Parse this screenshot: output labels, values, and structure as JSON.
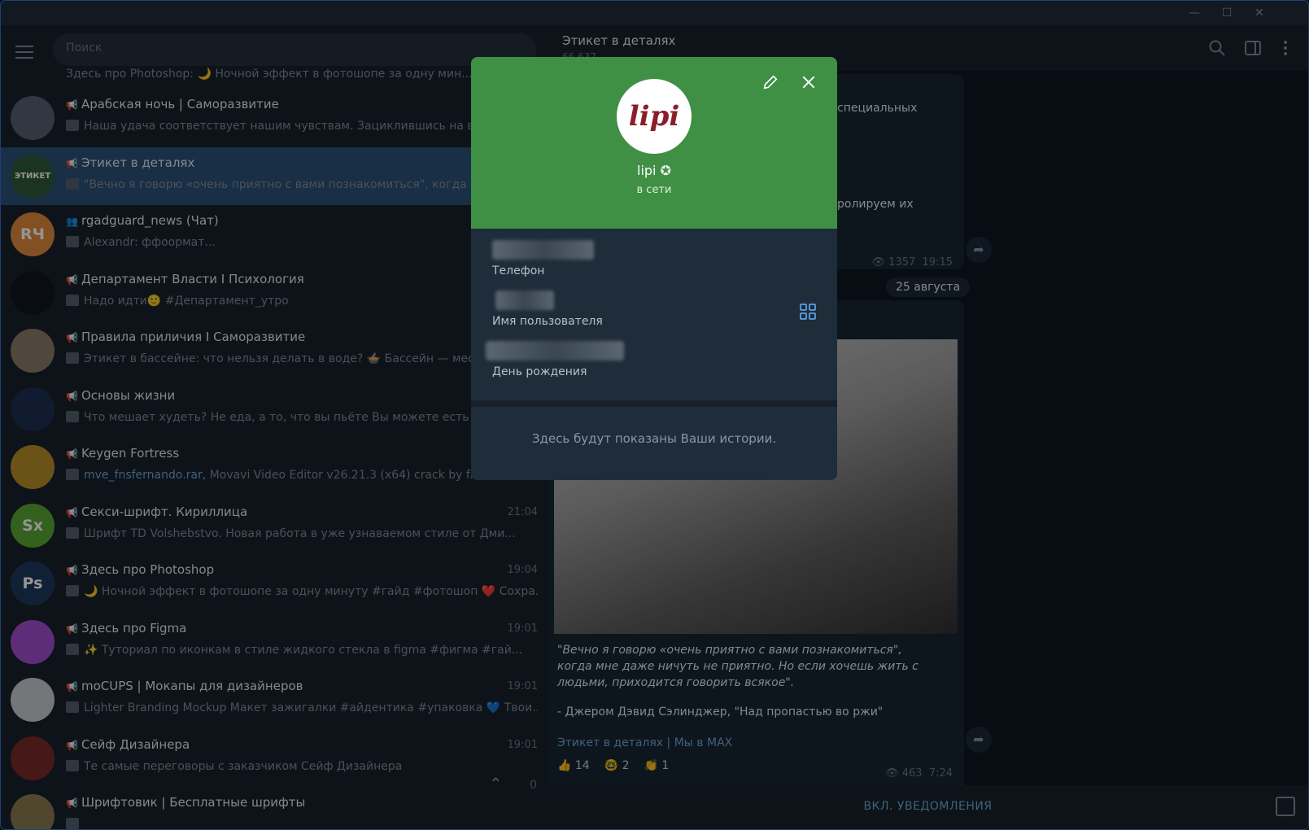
{
  "search": {
    "placeholder": "Поиск"
  },
  "chats": [
    {
      "name": "Арабская ночь | Саморазвитие",
      "time": "",
      "preview": "Наша удача соответствует нашим чувствам. Зациклившись на все...",
      "avatar": "",
      "color": "#566070",
      "link": ""
    },
    {
      "name": "Этикет в деталях",
      "time": "",
      "preview": "\"Вечно я говорю «очень приятно с вами познакомиться\", когда мне...",
      "avatar": "ЭТИКЕТ",
      "color": "#2e5a3a",
      "link": "",
      "selected": true
    },
    {
      "name": "rgadguard_news (Чат)",
      "time": "",
      "preview": "Alexandr: ффоормат...",
      "avatar": "RЧ",
      "color": "#e08a3c",
      "link": ""
    },
    {
      "name": "Департамент Власти I Психология",
      "time": "",
      "preview": "Надо идти🙂 #Департамент_утро",
      "avatar": "",
      "color": "#101820",
      "link": ""
    },
    {
      "name": "Правила приличия I Саморазвитие",
      "time": "",
      "preview": "Этикет в бассейне: что нельзя делать в воде? 🍲 Бассейн — место...",
      "avatar": "",
      "color": "#8a7a6a",
      "link": ""
    },
    {
      "name": "Основы жизни",
      "time": "",
      "preview": "Что мешает худеть? Не еда, а то, что вы пьёте  Вы можете есть пр...",
      "avatar": "",
      "color": "#1d2f52",
      "link": ""
    },
    {
      "name": "Keygen Fortress",
      "time": "",
      "preview": "Movavi Video Editor v26.21.3 (x64) crack by fnsfernando...",
      "avatar": "",
      "color": "#b8902a",
      "link": "mve_fnsfernando.rar,"
    },
    {
      "name": "Секси-шрифт. Кириллица",
      "time": "21:04",
      "preview": "Шрифт TD Volshebstvo. Новая работа в уже узнаваемом стиле от Дми...",
      "avatar": "Sx",
      "color": "#5aa832",
      "link": ""
    },
    {
      "name": "Здесь про Photoshop",
      "time": "19:04",
      "preview": "🌙 Ночной эффект в фотошопе за одну минуту #гайд #фотошоп  ❤️ Сохра...",
      "avatar": "Ps",
      "color": "#1c3a5e",
      "link": ""
    },
    {
      "name": "Здесь про Figma",
      "time": "19:01",
      "preview": "✨ Туториал по иконкам в стиле жидкого стекла в figma #фигма #гай...",
      "avatar": "",
      "color": "#a24fd0",
      "link": ""
    },
    {
      "name": "moCUPS | Мокапы для дизайнеров",
      "time": "19:01",
      "preview": "Lighter Branding Mockup  Макет зажигалки  #айдентика #упаковка  💙 Твои...",
      "avatar": "",
      "color": "#c8ccd0",
      "link": ""
    },
    {
      "name": "Сейф Дизайнера",
      "time": "19:01",
      "preview": "Те самые переговоры с заказчиком  Сейф Дизайнера",
      "avatar": "",
      "color": "#7a2a2a",
      "link": ""
    },
    {
      "name": "Шрифтовик | Бесплатные шрифты",
      "time": "",
      "preview": "",
      "avatar": "",
      "color": "#8a7a52",
      "link": ""
    }
  ],
  "top_preview": "Здесь про Photoshop: 🌙 Ночной эффект в фотошопе за одну мин...",
  "main": {
    "title": "Этикет в деталях",
    "subtitle": "66 637",
    "fragment1": "специальных",
    "fragment2": "ролируем их",
    "views1": "1357",
    "time1": "19:15",
    "date_chip": "25 августа",
    "quote": "\"Вечно я говорю «очень приятно с вами познакомиться\", когда мне даже ничуть не приятно. Но если хочешь жить с людьми, приходится говорить всякое\".",
    "author": "- Джером Дэвид Сэлинджер, \"Над пропастью во ржи\"",
    "link1": "Этикет в деталях",
    "link2": "Мы в MAX",
    "reactions": [
      {
        "emoji": "👍",
        "count": "14"
      },
      {
        "emoji": "🤓",
        "count": "2"
      },
      {
        "emoji": "👏",
        "count": "1"
      }
    ],
    "views2": "463",
    "time2": "7:24",
    "unread": "0",
    "footer_label": "ВКЛ. УВЕДОМЛЕНИЯ"
  },
  "profile": {
    "avatar_text": "lipi",
    "name": "lipi",
    "status": "в сети",
    "phone_label": "Телефон",
    "username_label": "Имя пользователя",
    "birthday_label": "День рождения",
    "stories_text": "Здесь будут показаны Ваши истории."
  },
  "colors": {
    "accent": "#3f8f45",
    "sidebar": "#17212b",
    "main_bg": "#0e1621",
    "selected": "#2b5278",
    "link": "#6fa7d6"
  }
}
